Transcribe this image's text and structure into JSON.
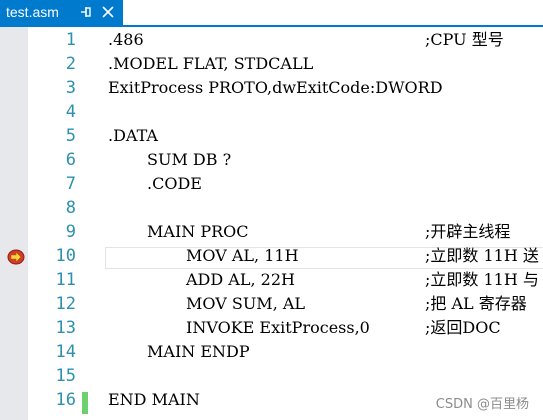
{
  "tab": {
    "title": "test.asm",
    "pin_icon": "pin-icon",
    "close_icon": "close-icon",
    "accent": "#007acc"
  },
  "line_numbers": [
    "1",
    "2",
    "3",
    "4",
    "5",
    "6",
    "7",
    "8",
    "9",
    "10",
    "11",
    "12",
    "13",
    "14",
    "15",
    "16"
  ],
  "current_line": "10",
  "breakpoint_icon": "breakpoint-arrow-icon",
  "code": {
    "l1": ".486",
    "l1_comment": ";CPU 型号",
    "l2": ".MODEL FLAT, STDCALL",
    "l3": "ExitProcess PROTO,dwExitCode:DWORD",
    "l5": ".DATA",
    "l6": "SUM DB ?",
    "l7": ".CODE",
    "l9": "MAIN PROC",
    "l9_comment": ";开辟主线程",
    "l10": "MOV AL, 11H",
    "l10_comment": ";立即数 11H 送",
    "l11": "ADD AL, 22H",
    "l11_comment": ";立即数 11H 与",
    "l12": "MOV SUM, AL",
    "l12_comment": ";把 AL 寄存器",
    "l13": "INVOKE ExitProcess,0",
    "l13_comment": ";返回DOC",
    "l14": "MAIN ENDP",
    "l16": "END MAIN"
  },
  "colors": {
    "line_number": "#2b91af",
    "change_bar": "#6ecf6e",
    "margin": "#e7e8ec"
  },
  "watermark": "CSDN @百里杨"
}
